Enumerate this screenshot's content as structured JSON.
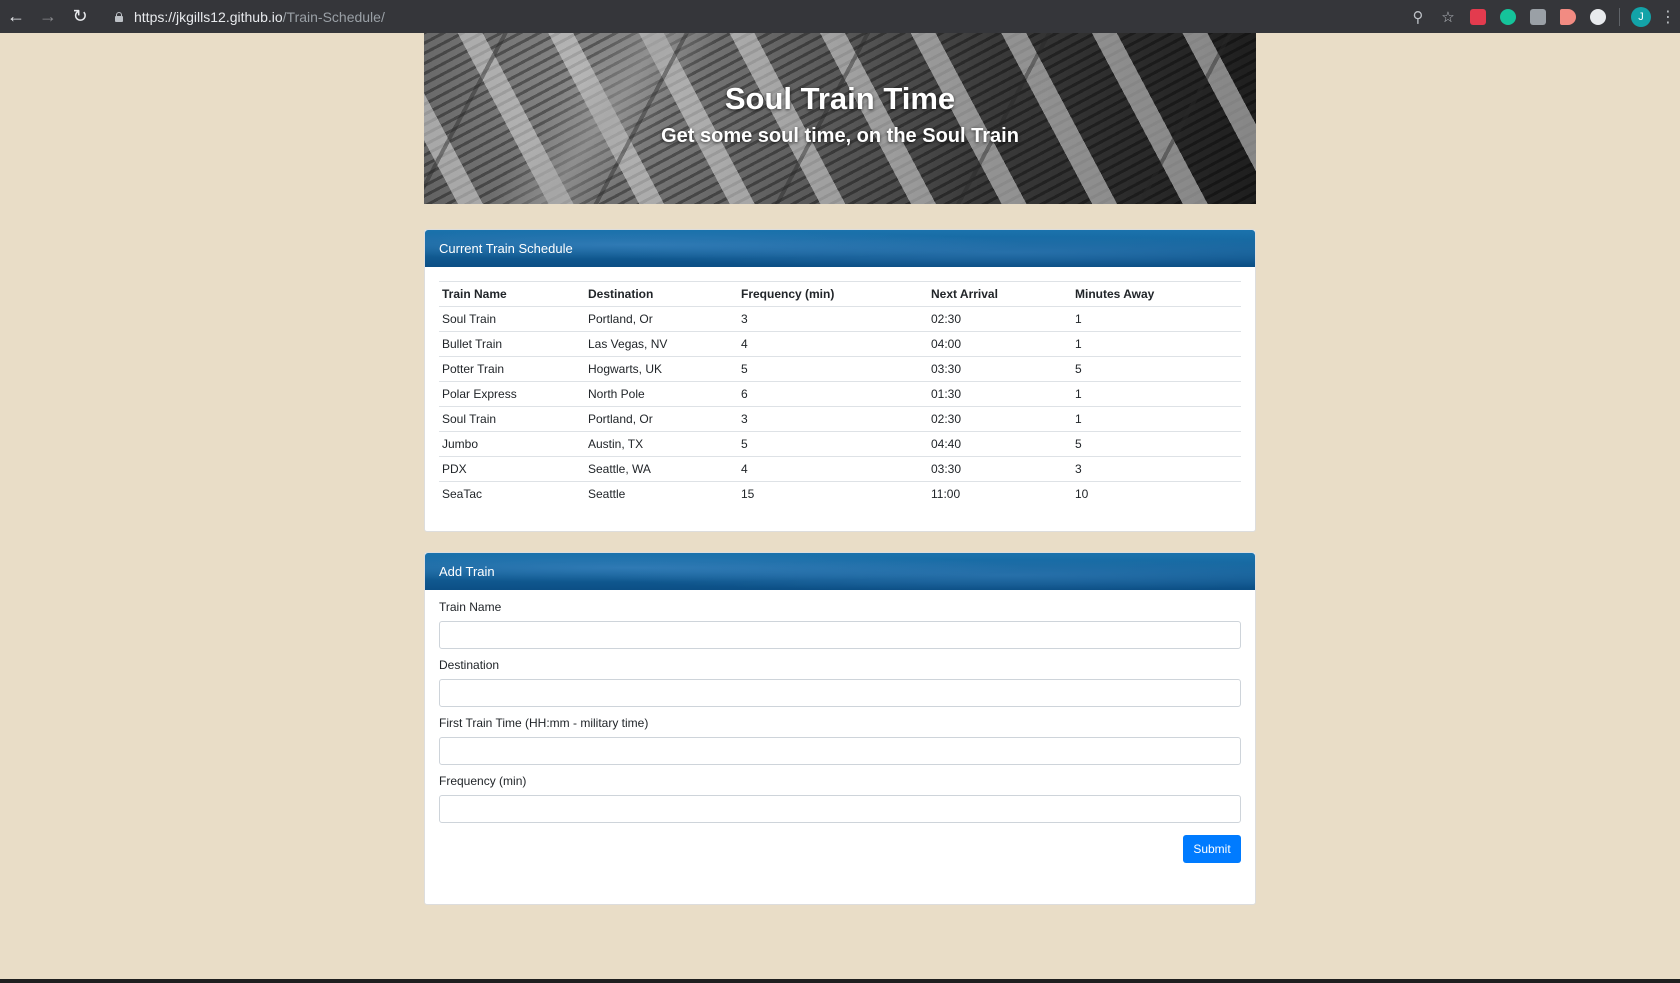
{
  "browser": {
    "url_host": "https://jkgills12.github.io",
    "url_path": "/Train-Schedule/",
    "profile_initial": "J"
  },
  "jumbotron": {
    "title": "Soul Train Time",
    "subtitle": "Get some soul time, on the Soul Train"
  },
  "schedule": {
    "header": "Current Train Schedule",
    "columns": [
      "Train Name",
      "Destination",
      "Frequency (min)",
      "Next Arrival",
      "Minutes Away"
    ],
    "rows": [
      [
        "Soul Train",
        "Portland, Or",
        "3",
        "02:30",
        "1"
      ],
      [
        "Bullet Train",
        "Las Vegas, NV",
        "4",
        "04:00",
        "1"
      ],
      [
        "Potter Train",
        "Hogwarts, UK",
        "5",
        "03:30",
        "5"
      ],
      [
        "Polar Express",
        "North Pole",
        "6",
        "01:30",
        "1"
      ],
      [
        "Soul Train",
        "Portland, Or",
        "3",
        "02:30",
        "1"
      ],
      [
        "Jumbo",
        "Austin, TX",
        "5",
        "04:40",
        "5"
      ],
      [
        "PDX",
        "Seattle, WA",
        "4",
        "03:30",
        "3"
      ],
      [
        "SeaTac",
        "Seattle",
        "15",
        "11:00",
        "10"
      ]
    ]
  },
  "add_train": {
    "header": "Add Train",
    "fields": [
      {
        "label": "Train Name",
        "value": ""
      },
      {
        "label": "Destination",
        "value": ""
      },
      {
        "label": "First Train Time (HH:mm - military time)",
        "value": ""
      },
      {
        "label": "Frequency (min)",
        "value": ""
      }
    ],
    "submit_label": "Submit"
  },
  "colors": {
    "page_bg": "#e9ddc7",
    "header_blue": "#0c4f85",
    "submit_blue": "#007bff"
  }
}
